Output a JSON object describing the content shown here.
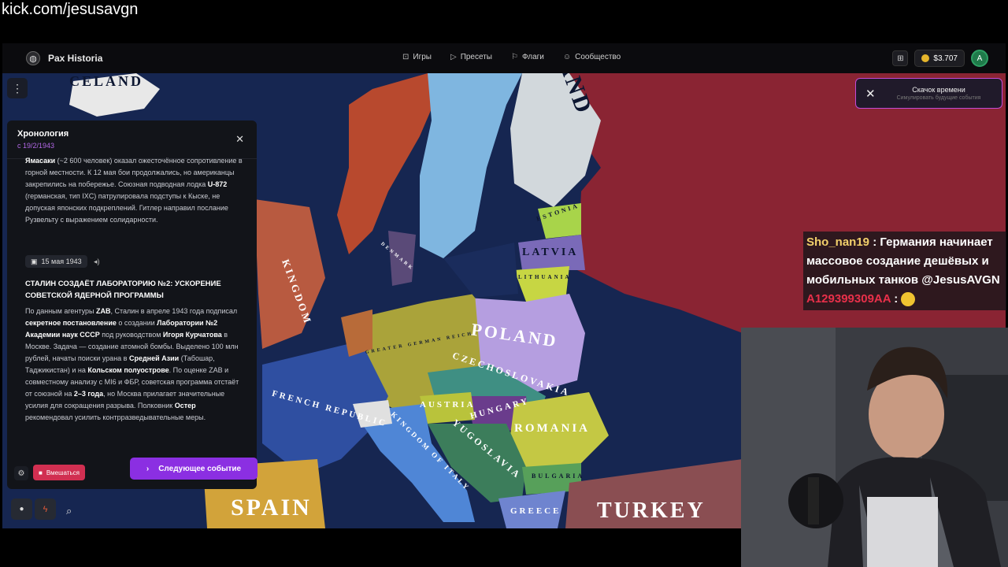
{
  "watermark": "kick.com/jesusavgn",
  "app": {
    "name": "Pax Historia",
    "nav": [
      {
        "label": "Игры",
        "icon": "gamepad-icon"
      },
      {
        "label": "Пресеты",
        "icon": "play-icon"
      },
      {
        "label": "Флаги",
        "icon": "flag-icon"
      },
      {
        "label": "Сообщество",
        "icon": "users-icon"
      }
    ],
    "balance": "$3.707",
    "avatar_letter": "A"
  },
  "time_jump": {
    "title": "Скачок времени",
    "subtitle": "Симулировать будущие события"
  },
  "timeline": {
    "title": "Хронология",
    "since": "с 19/2/1943",
    "entry_date": "15 мая 1943",
    "entry_title": "Сталин создаёт Лабораторию №2: ускорение советской ядерной программы"
  },
  "buttons": {
    "intervene": "Вмешаться",
    "next_event": "Следующее событие"
  },
  "map_labels": {
    "iceland": "CELAND",
    "estonia": "ESTONIA",
    "latvia": "LATVIA",
    "lithuania": "LITHUANIA",
    "poland": "POLAND",
    "germany": "GREATER GERMAN REICH",
    "czech": "CZECHOSLOVAKIA",
    "hungary": "HUNGARY",
    "romania": "ROMANIA",
    "austria": "AUSTRIA",
    "yugoslavia": "YUGOSLAVIA",
    "bulgaria": "BULGARIA",
    "france": "FRENCH REPUBLIC",
    "italy": "KINGDOM OF ITALY",
    "uk": "KINGDOM",
    "denmark": "DENMARK",
    "spain": "SPAIN",
    "turkey": "TURKEY",
    "greece": "GREECE",
    "finland": "AND"
  },
  "chat": {
    "user1": "Sho_nan19",
    "message1": "Германия начинает массовое создание дешёвых и мобильных танков @JesusAVGN",
    "user2": "A129399309AA",
    "separator": " : "
  },
  "colors": {
    "accent_purple": "#8b2fe2",
    "intervene_red": "#d12f51",
    "ussr_red": "#8a2433",
    "ocean": "#162651"
  }
}
